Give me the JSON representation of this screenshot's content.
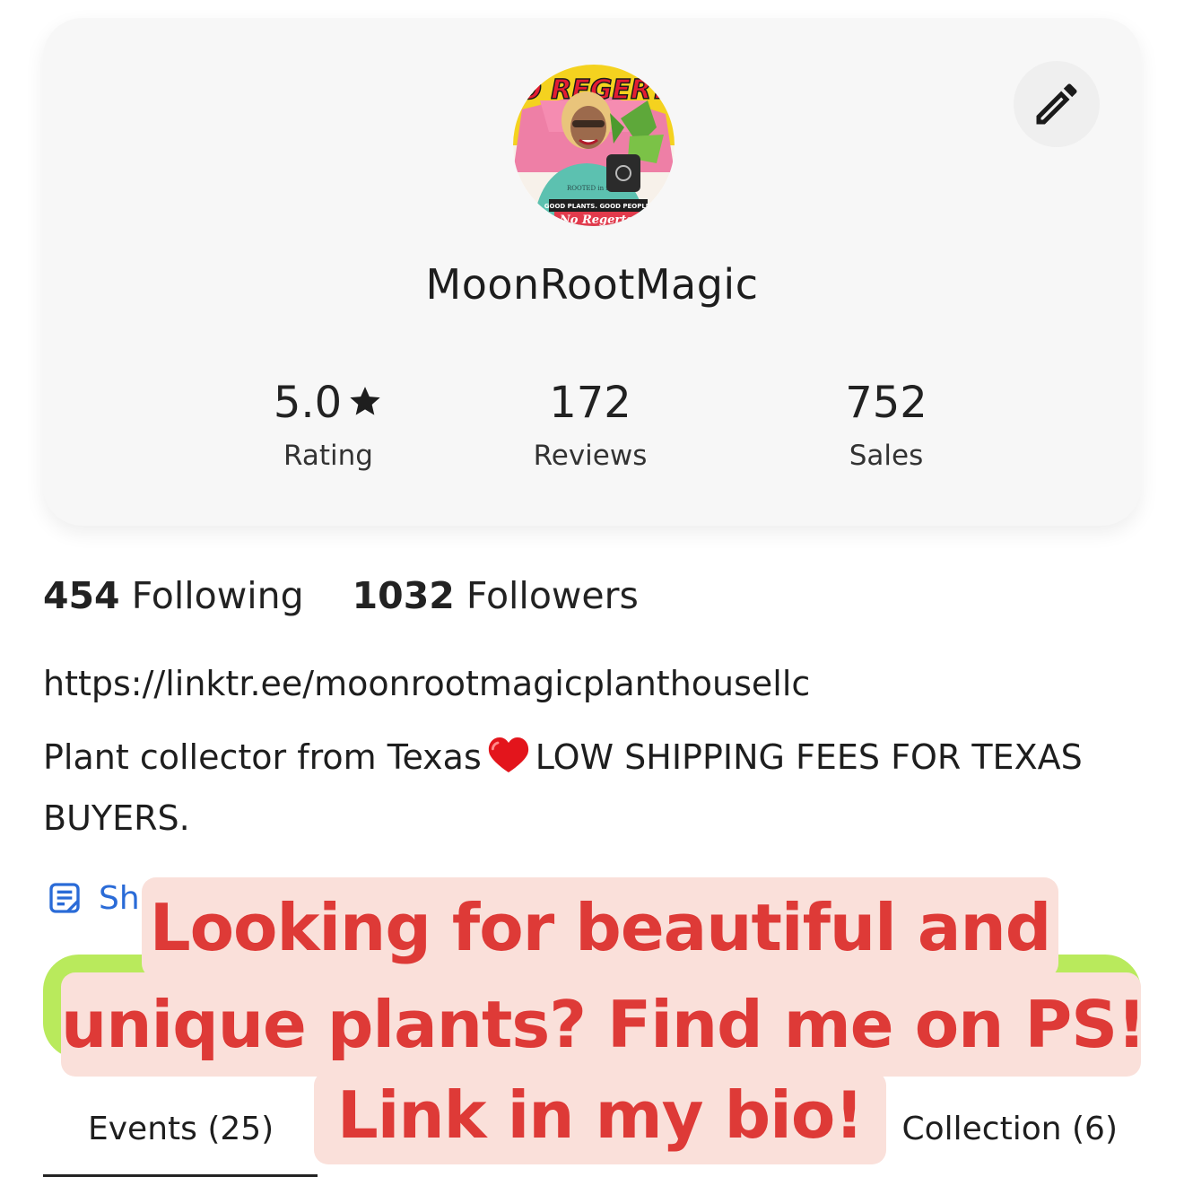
{
  "profile": {
    "username": "MoonRootMagic",
    "avatar": {
      "top_text": "NO REGERTS",
      "shirt_text": "ROOTED in magic",
      "banner_text": "GOOD PLANTS. GOOD PEOPLE.",
      "bottom_text": "No Regerts."
    },
    "edit_icon": "pencil-icon"
  },
  "stats": {
    "rating": {
      "value": "5.0",
      "label": "Rating",
      "icon": "star-icon"
    },
    "reviews": {
      "value": "172",
      "label": "Reviews"
    },
    "sales": {
      "value": "752",
      "label": "Sales"
    }
  },
  "follow": {
    "following_count": "454",
    "following_label": "Following",
    "followers_count": "1032",
    "followers_label": "Followers"
  },
  "bio": {
    "link": "https://linktr.ee/moonrootmagicplanthousellc",
    "text_before": "Plant collector from Texas",
    "text_after": "LOW SHIPPING FEES FOR TEXAS BUYERS."
  },
  "show_more": {
    "label": "Sh",
    "icon": "notes-icon"
  },
  "tabs": [
    {
      "label": "Events (25)",
      "active": true
    },
    {
      "label": "Collection (6)",
      "active": false
    }
  ],
  "overlay": {
    "line1": "Looking for beautiful and",
    "line2": "unique plants? Find me on PS!",
    "line3": "Link in my bio!"
  },
  "colors": {
    "card_bg": "#f7f7f7",
    "accent_green": "#b9ea5c",
    "link_blue": "#2a6bd7",
    "overlay_text": "#de3a37",
    "overlay_bg": "#fae0da"
  }
}
